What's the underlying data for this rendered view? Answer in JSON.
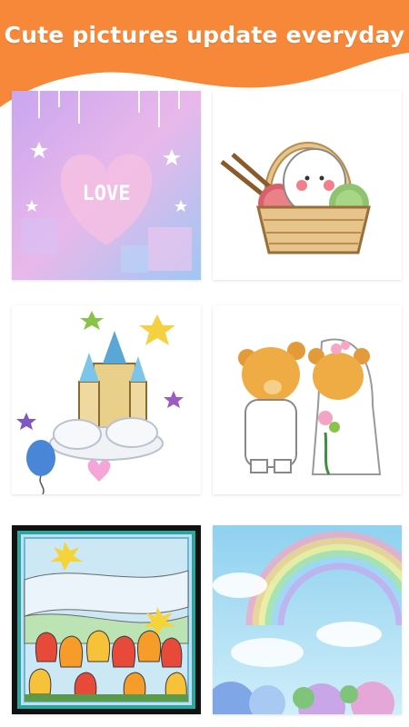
{
  "banner": {
    "headline": "Cute pictures update everyday",
    "color": "#F7883A"
  },
  "gallery": {
    "items": [
      {
        "name": "love-heart-picture",
        "text": "LOVE"
      },
      {
        "name": "cat-knitting-basket-picture"
      },
      {
        "name": "castle-cloud-picture"
      },
      {
        "name": "bear-wedding-picture"
      },
      {
        "name": "tulip-stained-glass-picture"
      },
      {
        "name": "rainbow-hydrangea-picture"
      }
    ]
  }
}
